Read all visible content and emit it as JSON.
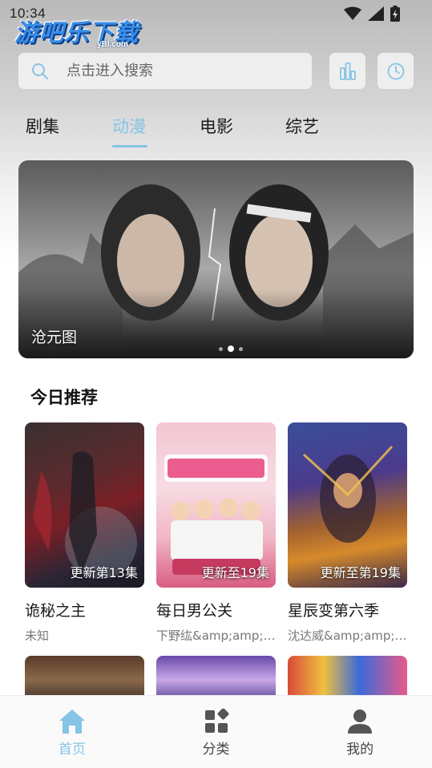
{
  "status_bar": {
    "time": "10:34"
  },
  "app": {
    "logo_text": "游吧乐下载",
    "logo_sub": "yBl.com"
  },
  "search": {
    "placeholder": "点击进入搜索"
  },
  "header_icons": [
    "chart-icon",
    "clock-icon"
  ],
  "tabs": [
    {
      "label": "剧集",
      "active": false
    },
    {
      "label": "动漫",
      "active": true
    },
    {
      "label": "电影",
      "active": false
    },
    {
      "label": "综艺",
      "active": false
    }
  ],
  "banner": {
    "caption": "沧元图",
    "slide_count": 3,
    "active_slide": 2
  },
  "section": {
    "title": "今日推荐"
  },
  "cards": [
    {
      "title": "诡秘之主",
      "subtitle": "未知",
      "badge": "更新第13集"
    },
    {
      "title": "每日男公关",
      "subtitle": "下野纮&amp;amp;amp;amp;...",
      "badge": "更新至19集"
    },
    {
      "title": "星辰变第六季",
      "subtitle": "沈达威&amp;amp;amp;amp;...",
      "badge": "更新至第19集"
    }
  ],
  "bottom_nav": [
    {
      "label": "首页",
      "icon": "home-icon",
      "active": true
    },
    {
      "label": "分类",
      "icon": "category-icon",
      "active": false
    },
    {
      "label": "我的",
      "icon": "user-icon",
      "active": false
    }
  ],
  "colors": {
    "accent": "#85c4e6",
    "logo_blue": "#3a8de8"
  }
}
